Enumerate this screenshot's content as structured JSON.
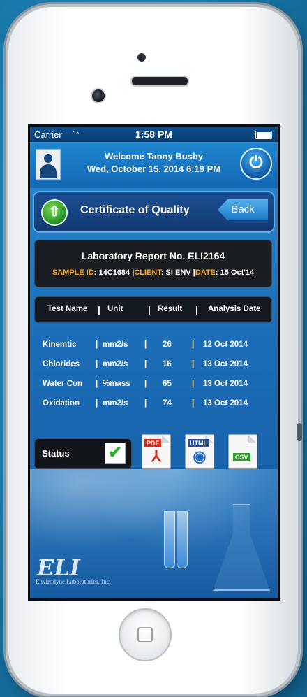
{
  "statusbar": {
    "carrier": "Carrier",
    "time": "1:58 PM"
  },
  "header": {
    "welcome_line1": "Welcome Tanny Busby",
    "welcome_line2": "Wed, October 15, 2014 6:19 PM"
  },
  "page": {
    "title": "Certificate of Quality",
    "back_label": "Back"
  },
  "report": {
    "title": "Laboratory Report No. ELI2164",
    "sample_label": "SAMPLE ID",
    "sample_value": ": 14C1684",
    "client_label": "CLIENT",
    "client_value": ": SI ENV",
    "date_label": "DATE",
    "date_value": ": 15 Oct'14"
  },
  "table": {
    "headers": [
      "Test Name",
      "Unit",
      "Result",
      "Analysis Date"
    ],
    "rows": [
      {
        "name": "Kinemtic",
        "unit": "mm2/s",
        "result": "26",
        "date": "12 Oct 2014"
      },
      {
        "name": "Chlorides",
        "unit": "mm2/s",
        "result": "16",
        "date": "13 Oct 2014"
      },
      {
        "name": "Water Con",
        "unit": "%mass",
        "result": "65",
        "date": "13 Oct 2014"
      },
      {
        "name": "Oxidation",
        "unit": "mm2/s",
        "result": "74",
        "date": "13 Oct 2014"
      }
    ]
  },
  "status": {
    "label": "Status",
    "checked": true
  },
  "exports": {
    "pdf": "PDF",
    "html": "HTML",
    "csv": "CSV"
  },
  "footer": {
    "logo": "ELI",
    "company": "Envirodyne Laboratories, Inc."
  },
  "colors": {
    "accent": "#1f86d0",
    "highlight": "#f5a623",
    "ok": "#2fb12f"
  }
}
